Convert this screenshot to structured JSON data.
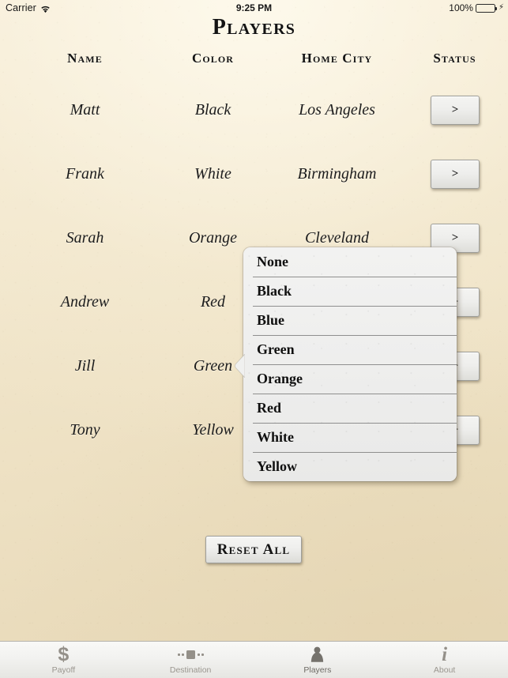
{
  "statusbar": {
    "carrier": "Carrier",
    "wifi_icon": "wifi-icon",
    "time": "9:25 PM",
    "battery_percent": "100%",
    "battery_icon": "battery-icon",
    "charging_icon": "lightning-bolt-icon",
    "battery_color": "#3ad348"
  },
  "header": {
    "title": "Players"
  },
  "table": {
    "columns": [
      "Name",
      "Color",
      "Home City",
      "Status"
    ],
    "rows": [
      {
        "name": "Matt",
        "color": "Black",
        "city": "Los Angeles",
        "status_label": ">"
      },
      {
        "name": "Frank",
        "color": "White",
        "city": "Birmingham",
        "status_label": ">"
      },
      {
        "name": "Sarah",
        "color": "Orange",
        "city": "Cleveland",
        "status_label": ">"
      },
      {
        "name": "Andrew",
        "color": "Red",
        "city": "",
        "status_label": ">"
      },
      {
        "name": "Jill",
        "color": "Green",
        "city": "",
        "status_label": ">"
      },
      {
        "name": "Tony",
        "color": "Yellow",
        "city": "",
        "status_label": ">"
      }
    ]
  },
  "reset": {
    "label": "Reset All"
  },
  "color_popover": {
    "visible": true,
    "anchor_row": "Jill",
    "options": [
      "None",
      "Black",
      "Blue",
      "Green",
      "Orange",
      "Red",
      "White",
      "Yellow"
    ]
  },
  "tabbar": {
    "selected": "Players",
    "tabs": [
      {
        "label": "Payoff",
        "icon": "dollar-sign-icon"
      },
      {
        "label": "Destination",
        "icon": "route-marker-icon"
      },
      {
        "label": "Players",
        "icon": "pawn-icon"
      },
      {
        "label": "About",
        "icon": "info-icon"
      }
    ]
  },
  "theme": {
    "paper": "#f2e7cd",
    "ink": "#131313",
    "button_face": "#eeeeec",
    "tabbar_tint": "#949089",
    "tabbar_selected": "#75726c"
  }
}
